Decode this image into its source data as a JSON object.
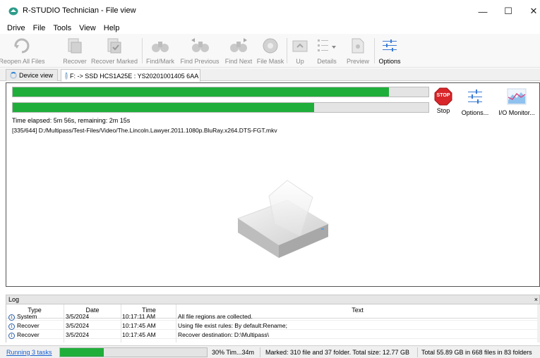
{
  "window": {
    "title": "R-STUDIO Technician - File view",
    "minimize_glyph": "—",
    "maximize_glyph": "☐",
    "close_glyph": "✕"
  },
  "menu": [
    "Drive",
    "File",
    "Tools",
    "View",
    "Help"
  ],
  "toolbar": {
    "reopen": "Reopen All Files",
    "recover": "Recover",
    "recover_marked": "Recover Marked",
    "find_mark": "Find/Mark",
    "find_previous": "Find Previous",
    "find_next": "Find Next",
    "file_mask": "File Mask",
    "up": "Up",
    "details": "Details",
    "preview": "Preview",
    "options": "Options"
  },
  "tabs": {
    "device_view": "Device view",
    "file_tab": "F: -> SSD HCS1A25E : YS20201001405 6AA"
  },
  "scan": {
    "overall_progress": 0.905,
    "file_progress": 0.725,
    "time_text": "Time elapsed: 5m 56s, remaining: 2m 15s",
    "current_file": "[335/644] D:/Multipass/Test-Files/Video/The.Lincoln.Lawyer.2011.1080p.BluRay.x264.DTS-FGT.mkv"
  },
  "actions": {
    "stop_icon_text": "STOP",
    "stop": "Stop",
    "options": "Options...",
    "io_monitor": "I/O Monitor..."
  },
  "log": {
    "title": "Log",
    "close_glyph": "×",
    "columns": {
      "type": "Type",
      "date": "Date",
      "time": "Time",
      "text": "Text"
    },
    "rows": [
      {
        "type": "System",
        "date": "3/5/2024",
        "time": "10:17:11 AM",
        "text": "All file regions are collected."
      },
      {
        "type": "Recover",
        "date": "3/5/2024",
        "time": "10:17:45 AM",
        "text": "Using file exist rules: By default:Rename;"
      },
      {
        "type": "Recover",
        "date": "3/5/2024",
        "time": "10:17:45 AM",
        "text": "Recover destination: D:\\Multipass\\"
      }
    ]
  },
  "statusbar": {
    "tasks_link": "Running 3 tasks",
    "task_progress": 0.3,
    "progress_text": "30% Tim...34m",
    "marked_text": "Marked: 310 file and 37 folder. Total size: 12.77 GB",
    "total_text": "Total 55.89 GB in 668 files in 83 folders"
  },
  "colors": {
    "progress_green": "#1fae3a",
    "stop_red": "#d8262a",
    "link_blue": "#1a5fd1"
  }
}
